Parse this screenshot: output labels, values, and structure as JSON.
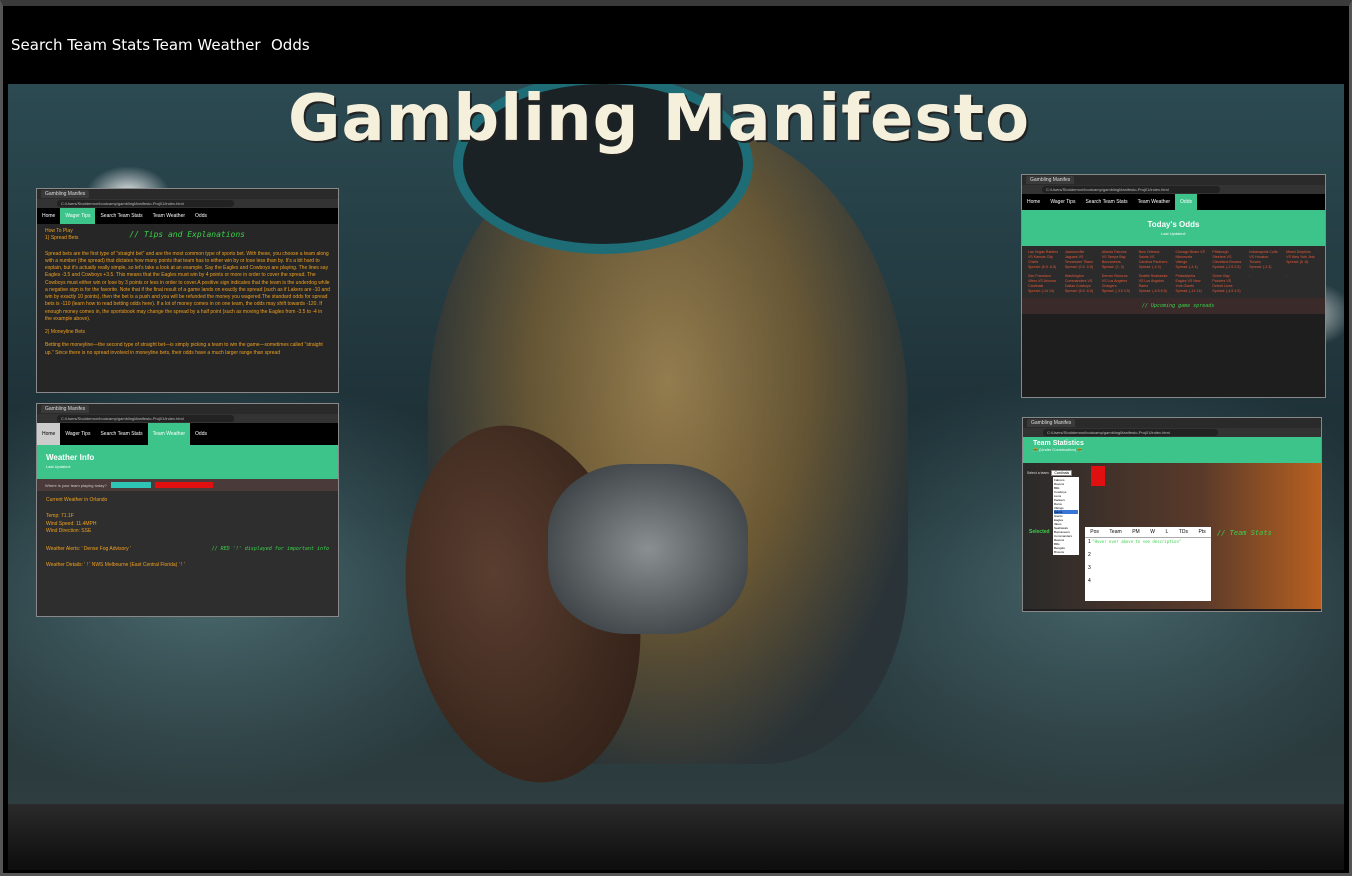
{
  "nav": {
    "items": [
      "Search Team Stats",
      "Team Weather",
      "Odds"
    ]
  },
  "hero": {
    "title": "Gambling Manifesto"
  },
  "mini_windows": {
    "tab_label": "Gambling Manifes",
    "address": "C:/Users/Stoddemon/bootcamp/gamblingManifesto-Proj01/index.html",
    "site_nav": [
      "Home",
      "Wager Tips",
      "Search Team Stats",
      "Team Weather",
      "Odds"
    ],
    "tips": {
      "how_to_play": "How To Play",
      "spread_heading": "1) Spread Bets",
      "comment": "// Tips and Explanations",
      "spread_text": "Spread bets are the first type of \"straight bet\" and are the most common type of sports bet. With these, you choose a team along with a number (the spread) that dictates how many points that team has to either win by or lose less than by. It's a bit hard to explain, but it's actually really simple, so let's take a look at an example. Say the Eagles and Cowboys are playing. The lines say Eagles -3.5 and Cowboys +3.5. This means that the Eagles must win by 4 points or more in order to cover the spread. The Cowboys must either win or lose by 3 points or less in order to cover.A positive sign indicates that the team is the underdog while a negative sign is for the favorite. Note that if the final result of a game lands on exactly the spread (such as if Lakers are -10 and win by exactly 10 points), then the bet is a push and you will be refunded the money you wagered.The standard odds for spread bets is -110 (learn how to read betting odds here). If a lot of money comes in on one team, the odds may shift towards -120. If enough money comes in, the sportsbook may change the spread by a half point (such as moving the Eagles from -3.5 to -4 in the example above).",
      "moneyline_heading": "2) Moneyline Bets",
      "moneyline_text": "Betting the moneyline—the second type of straight bet—is simply picking a team to win the game—sometimes called \"straight up.\" Since there is no spread involved in moneyline bets, their odds have a much larger range than spread"
    },
    "weather": {
      "title": "Weather Info",
      "last_updated": "Last Updated:",
      "question": "Where is your team playing today?",
      "current": "Current Weather in Orlando",
      "temp": "Temp: 71.1F",
      "wind_speed": "Wind Speed: 11.4MPH",
      "wind_direction": "Wind Direction: SSE",
      "alerts": "Weather Alerts: ' Dense Fog Advisory '",
      "comment": "// RED '!' displayed for important info",
      "details": "Weather Details: ' ! ' NWS Melbourne (East Central Florida) ' ! '"
    },
    "odds": {
      "title": "Today's Odds",
      "last_updated": "Last Updated:",
      "comment": "// Upcoming game spreads",
      "games": [
        [
          "Las Vegas Raiders",
          "VS Kansas City",
          "Chiefs",
          "Spread: (6.5 -6.5)"
        ],
        [
          "Jacksonville",
          "Jaguars VS",
          "Tennessee Titans",
          "Spread: (0.5 -0.5)"
        ],
        [
          "Atlanta Falcons",
          "VS Tampa Bay",
          "Buccaneers",
          "Spread: (3 -3)"
        ],
        [
          "New Orleans",
          "Saints VS",
          "Carolina Panthers",
          "Spread: (-4 4)"
        ],
        [
          "Chicago Bears VS",
          "Minnesota",
          "Vikings",
          "Spread: (-4 4)"
        ],
        [
          "Pittsburgh",
          "Steelers VS",
          "Cleveland Browns",
          "Spread: (-2.5 2.5)"
        ],
        [
          "Indianapolis Colts",
          "VS Houston",
          "Texans",
          "Spread: (-3 3)"
        ],
        [
          "Miami Dolphins",
          "VS New York Jets",
          "Spread: (6 -6)"
        ],
        [
          "San Francisco",
          "49ers VS Arizona",
          "Cardinals",
          "Spread: (-14 14)"
        ],
        [
          "Washington",
          "Commanders VS",
          "Dallas Cowboys",
          "Spread: (6.5 -6.5)"
        ],
        [
          "Denver Broncos",
          "VS Los Angeles",
          "Chargers",
          "Spread: (-3.5 3.5)"
        ],
        [
          "Seattle Seahawks",
          "VS Los Angeles",
          "Rams",
          "Spread: (-6.5 6.5)"
        ],
        [
          "Philadelphia",
          "Eagles VS New",
          "York Giants",
          "Spread: (-14 14)"
        ],
        [
          "Green Bay",
          "Packers VS",
          "Detroit Lions",
          "Spread: (-4.5 4.5)"
        ],
        [
          "-",
          "",
          "",
          ""
        ],
        [
          "-",
          "",
          "",
          ""
        ]
      ]
    },
    "team_stats": {
      "title": "Team Statistics",
      "subtitle": "🚧 (Under Construction) 🚧",
      "select_label": "Select a team:",
      "select_value": "Cardinals",
      "teams": [
        "Falcons",
        "Ravens",
        "Bills",
        "Cowboys",
        "Lions",
        "Packers",
        "Rams",
        "Vikings",
        "Saints",
        "Giants",
        "Eagles",
        "49ers",
        "Seahawks",
        "Buccaneers",
        "Commanders",
        "Ravens",
        "Bills",
        "Bengals",
        "Browns"
      ],
      "selected_label": "Selected",
      "columns": [
        "Pos",
        "Team",
        "PM",
        "W",
        "L",
        "TDs",
        "Pts"
      ],
      "rows": [
        "1",
        "2",
        "3",
        "4"
      ],
      "hover_hint": "\"Hover over above to see description\"",
      "comment": "// Team Stats"
    }
  },
  "colors": {
    "accent_green": "#3cc48a",
    "code_green": "#3bd14a",
    "tips_orange": "#f0a020"
  }
}
